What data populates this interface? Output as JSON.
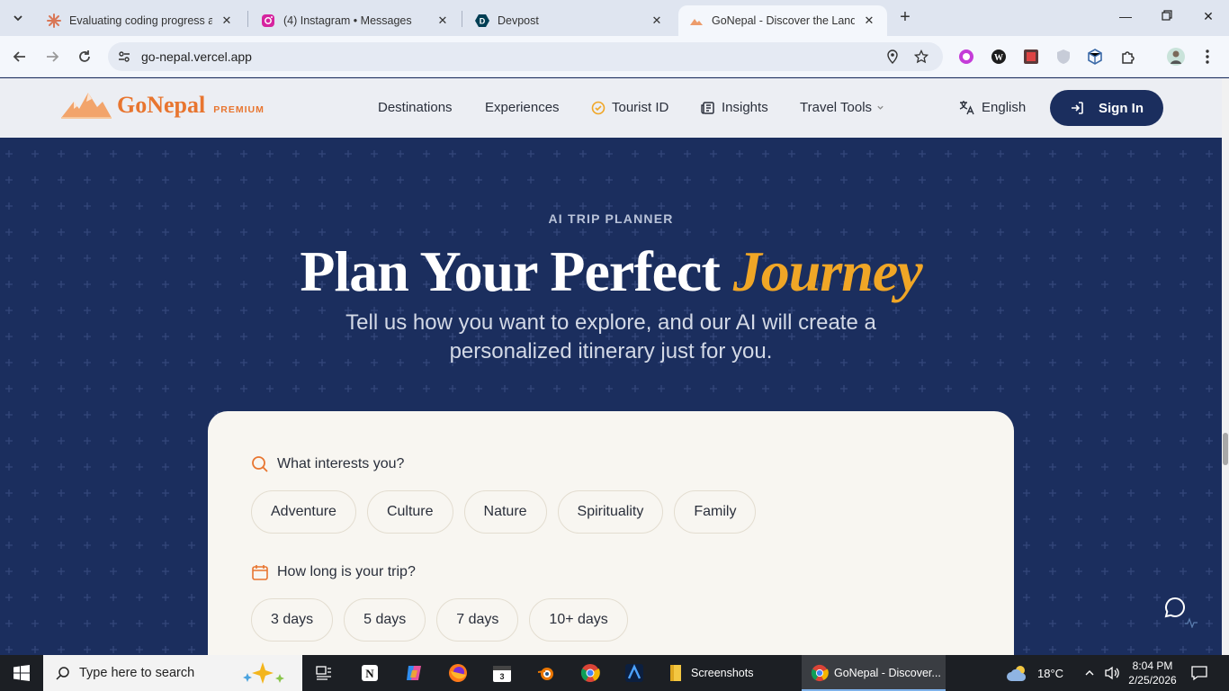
{
  "browser": {
    "tabs": [
      {
        "title": "Evaluating coding progress as a",
        "favicon": "claude-asterisk-icon"
      },
      {
        "title": "(4) Instagram • Messages",
        "favicon": "instagram-icon"
      },
      {
        "title": "Devpost",
        "favicon": "devpost-icon"
      },
      {
        "title": "GoNepal - Discover the Land of",
        "favicon": "mountain-icon"
      }
    ],
    "url": "go-nepal.vercel.app"
  },
  "site": {
    "brand": "GoNepal",
    "badge": "PREMIUM",
    "nav": [
      "Destinations",
      "Experiences",
      "Tourist ID",
      "Insights",
      "Travel Tools"
    ],
    "language": "English",
    "sign_in": "Sign In"
  },
  "hero": {
    "eyebrow": "AI TRIP PLANNER",
    "headline_main": "Plan Your Perfect",
    "headline_accent": "Journey",
    "subheadline": "Tell us how you want to explore, and our AI will create a personalized itinerary just for you."
  },
  "planner": {
    "interests_question": "What interests you?",
    "interests": [
      "Adventure",
      "Culture",
      "Nature",
      "Spirituality",
      "Family"
    ],
    "duration_question": "How long is your trip?",
    "durations": [
      "3 days",
      "5 days",
      "7 days",
      "10+ days"
    ]
  },
  "taskbar": {
    "search_placeholder": "Type here to search",
    "apps": [
      {
        "label": "Screenshots",
        "icon": "folder-icon"
      },
      {
        "label": "GoNepal - Discover...",
        "icon": "chrome-icon"
      }
    ],
    "weather": "18°C",
    "time": "8:04 PM",
    "date": "2/25/2026"
  },
  "colors": {
    "navy": "#1b2e5e",
    "orange": "#e8752f",
    "gold": "#f0a626",
    "card": "#f8f6f1"
  }
}
